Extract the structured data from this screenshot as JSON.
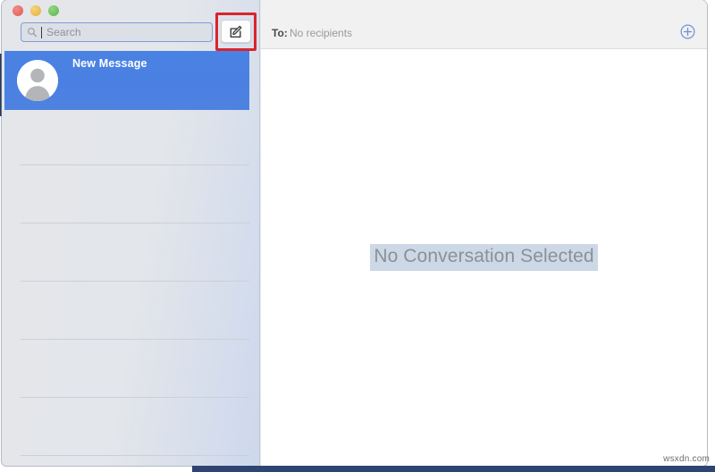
{
  "window": {
    "traffic_lights": [
      {
        "name": "close",
        "color": "#df5b50"
      },
      {
        "name": "minimize",
        "color": "#e4ae3f"
      },
      {
        "name": "maximize",
        "color": "#5cb34c"
      }
    ]
  },
  "sidebar": {
    "search": {
      "icon": "search-icon",
      "placeholder": "Search",
      "value": ""
    },
    "compose": {
      "icon": "compose-icon",
      "label": "",
      "highlight_color": "#d9252a"
    },
    "conversations": [
      {
        "title": "New Message",
        "avatar": "person-placeholder-avatar",
        "selected": true,
        "selection_color": "#4a80e2"
      }
    ],
    "empty_row_count": 6
  },
  "main": {
    "to_field": {
      "label": "To:",
      "value": "No recipients",
      "add_button_icon": "plus-circle-icon"
    },
    "empty_state": {
      "text": "No Conversation Selected",
      "highlight_color": "#ccd8e6"
    }
  },
  "watermark": {
    "text": "wsxdn.com"
  }
}
